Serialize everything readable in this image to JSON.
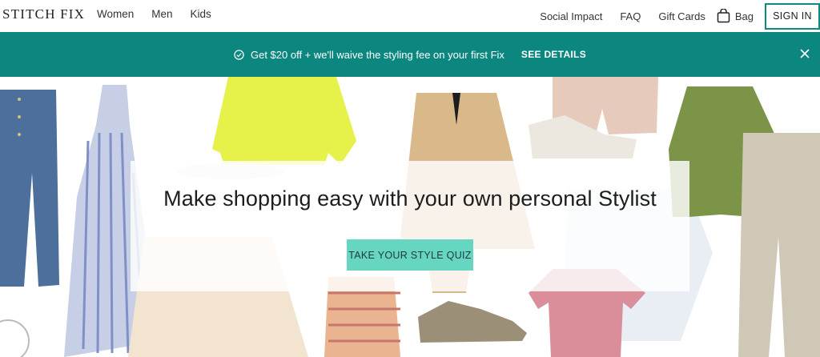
{
  "brand": {
    "logo_text": "STITCH FIX"
  },
  "nav": {
    "left": [
      "Women",
      "Men",
      "Kids"
    ],
    "right": [
      "Social Impact",
      "FAQ",
      "Gift Cards"
    ],
    "bag_label": "Bag",
    "signin_label": "SIGN IN"
  },
  "promo": {
    "message": "Get $20 off + we'll waive the styling fee on your first Fix",
    "details_label": "SEE DETAILS"
  },
  "hero": {
    "headline": "Make shopping easy with your own personal Stylist",
    "cta_label": "TAKE YOUR STYLE QUIZ"
  },
  "colors": {
    "accent": "#0c877f",
    "cta": "#66d6c3"
  }
}
